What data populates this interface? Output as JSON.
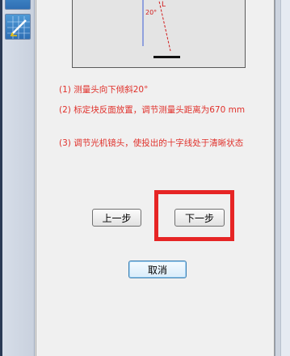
{
  "illustration": {
    "angle_label": "20°",
    "arm_label": "L"
  },
  "instructions": [
    "(1) 测量头向下倾斜20°",
    "(2) 标定块反面放置，调节测量头距离为670 mm",
    "(3) 调节光机镜头，使投出的十字线处于清晰状态"
  ],
  "buttons": {
    "prev": "上一步",
    "next": "下一步",
    "cancel": "取消"
  },
  "colors": {
    "instruction_text": "#e0312b",
    "highlight_box": "#e62525"
  },
  "icons": [
    "pen-icon"
  ]
}
